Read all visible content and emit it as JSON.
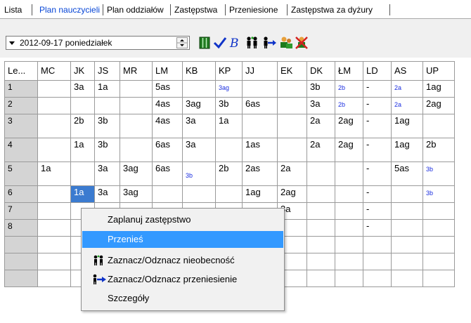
{
  "tabs": [
    {
      "label": "Lista",
      "selected": false
    },
    {
      "label": "Plan nauczycieli",
      "selected": true
    },
    {
      "label": "Plan oddziałów",
      "selected": false
    },
    {
      "label": "Zastępstwa",
      "selected": false
    },
    {
      "label": "Przeniesione",
      "selected": false
    },
    {
      "label": "Zastępstwa za dyżury",
      "selected": false
    }
  ],
  "toolbar": {
    "date": "2012-09-17 poniedziałek",
    "icons": [
      "columns-icon",
      "checkmark-icon",
      "script-b-icon",
      "persons-absence-icon",
      "person-move-icon",
      "people-swap-icon",
      "people-remove-icon"
    ]
  },
  "grid": {
    "headers": [
      "Le...",
      "MC",
      "JK",
      "JS",
      "MR",
      "LM",
      "KB",
      "KP",
      "JJ",
      "EK",
      "DK",
      "ŁM",
      "LD",
      "AS",
      "UP"
    ],
    "rows": [
      {
        "label": "1",
        "cells": [
          "",
          "3a",
          "1a",
          "",
          "5as",
          "",
          "3ag",
          "",
          "",
          "3b",
          "2b",
          "-",
          "2a",
          "1ag"
        ]
      },
      {
        "label": "2",
        "cells": [
          "",
          "",
          "",
          "",
          "4as",
          "3ag",
          "3b",
          "6as",
          "",
          "3a",
          "2b",
          "-",
          "2a",
          "2ag"
        ]
      },
      {
        "label": "3",
        "cells": [
          "",
          "2b",
          "3b",
          "",
          "4as",
          "3a",
          "1a",
          "",
          "",
          "2a",
          "2ag",
          "-",
          "1ag",
          ""
        ]
      },
      {
        "label": "4",
        "cells": [
          "",
          "1a",
          "3b",
          "",
          "6as",
          "3a",
          "",
          "1as",
          "",
          "2a",
          "2ag",
          "-",
          "1ag",
          "2b"
        ]
      },
      {
        "label": "5",
        "cells": [
          "1a",
          "",
          "3a",
          "3ag",
          "6as",
          "3b",
          "2b",
          "2as",
          "2a",
          "",
          "",
          "-",
          "5as",
          "3b"
        ]
      },
      {
        "label": "6",
        "cells": [
          "",
          "1a",
          "3a",
          "3ag",
          "",
          "",
          "",
          "1ag",
          "2ag",
          "",
          "",
          "-",
          "",
          "3b"
        ]
      },
      {
        "label": "7",
        "cells": [
          "",
          "",
          "",
          "",
          "",
          "",
          "",
          "",
          "3a",
          "",
          "",
          "-",
          "",
          ""
        ]
      },
      {
        "label": "8",
        "cells": [
          "",
          "",
          "",
          "",
          "",
          "",
          "",
          "",
          "",
          "",
          "",
          "-",
          "",
          ""
        ]
      },
      {
        "label": "",
        "cells": [
          "",
          "",
          "",
          "",
          "",
          "",
          "",
          "",
          "",
          "",
          "",
          "",
          "",
          ""
        ]
      },
      {
        "label": "",
        "cells": [
          "",
          "",
          "",
          "",
          "",
          "",
          "",
          "",
          "",
          "",
          "",
          "",
          "",
          ""
        ]
      },
      {
        "label": "",
        "cells": [
          "",
          "",
          "",
          "",
          "",
          "",
          "",
          "",
          "",
          "",
          "",
          "",
          "",
          ""
        ]
      }
    ]
  },
  "context_menu": {
    "items": [
      {
        "label": "Zaplanuj zastępstwo",
        "icon": "",
        "highlighted": false
      },
      {
        "label": "Przenieś",
        "icon": "",
        "highlighted": true
      },
      {
        "label": "Zaznacz/Odznacz nieobecność",
        "icon": "persons-absence-icon",
        "highlighted": false
      },
      {
        "label": "Zaznacz/Odznacz przeniesienie",
        "icon": "person-move-icon",
        "highlighted": false
      },
      {
        "label": "Szczegóły",
        "icon": "",
        "highlighted": false
      }
    ]
  }
}
